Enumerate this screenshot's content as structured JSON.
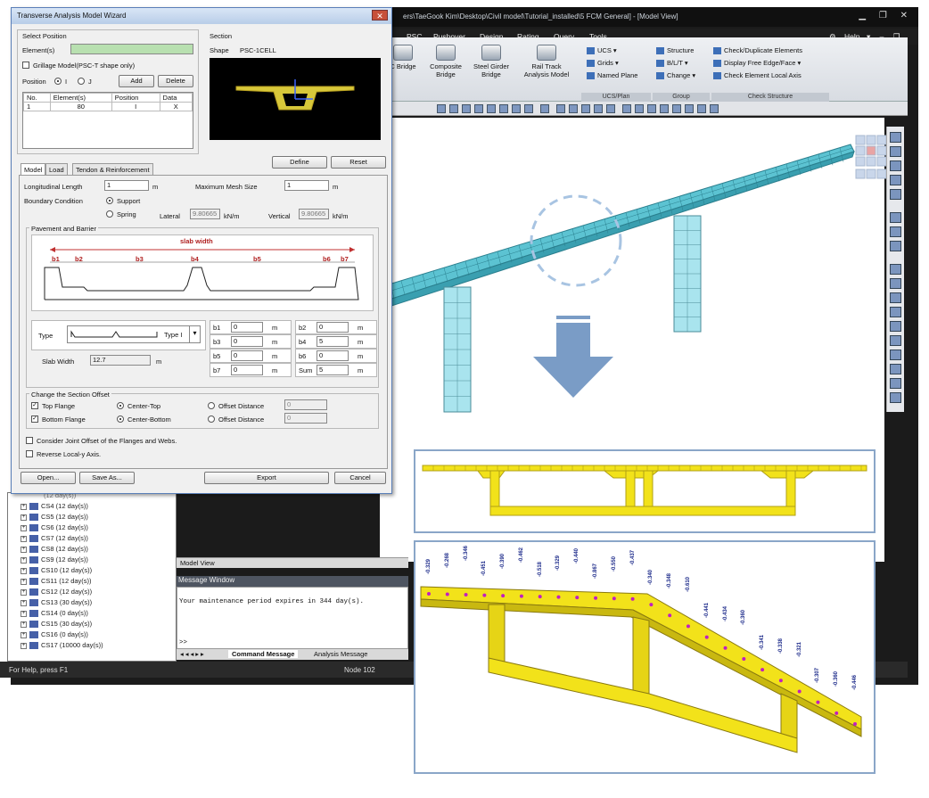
{
  "app": {
    "title_path": "ers\\TaeGook Kim\\Desktop\\Civil model\\Tutorial_installed\\5 FCM General] - [Model View]",
    "help": "Help",
    "menu": [
      "PSC",
      "Pushover",
      "Design",
      "Rating",
      "Query",
      "Tools"
    ],
    "ribbon": {
      "big_buttons": [
        {
          "l1": "C Bridge",
          "l2": ""
        },
        {
          "l1": "Composite",
          "l2": "Bridge"
        },
        {
          "l1": "Steel Girder",
          "l2": "Bridge"
        },
        {
          "l1": "Rail Track",
          "l2": "Analysis Model"
        }
      ],
      "ucs_items": [
        "UCS",
        "Grids",
        "Named Plane"
      ],
      "group_items": [
        "Structure",
        "B/L/T",
        "Change"
      ],
      "check_items": [
        "Check/Duplicate Elements",
        "Display Free Edge/Face",
        "Check Element Local Axis"
      ],
      "group_labels": [
        "UCS/Plan",
        "Group",
        "Check Structure"
      ]
    },
    "tree_items": [
      "CS4 (12 day(s))",
      "CS5 (12 day(s))",
      "CS6 (12 day(s))",
      "CS7 (12 day(s))",
      "CS8 (12 day(s))",
      "CS9 (12 day(s))",
      "CS10 (12 day(s))",
      "CS11 (12 day(s))",
      "CS12 (12 day(s))",
      "CS13 (30 day(s))",
      "CS14 (0 day(s))",
      "CS15 (30 day(s))",
      "CS16 (0 day(s))",
      "CS17 (10000 day(s))"
    ],
    "tree_partial": "(12 day(s))",
    "model_view_tab": "Model View",
    "message_window": "Message Window",
    "message_text": "Your maintenance period expires in 344 day(s).",
    "prompt": ">>",
    "msg_tabs": [
      "Command Message",
      "Analysis Message"
    ],
    "status_left": "For Help, press F1",
    "status_node": "Node 102"
  },
  "dialog": {
    "title": "Transverse Analysis Model Wizard",
    "select_position": "Select Position",
    "elements_label": "Element(s)",
    "grillage": "Grillage Model(PSC-T shape only)",
    "position_label": "Position",
    "pos_i": "I",
    "pos_j": "J",
    "add": "Add",
    "delete": "Delete",
    "table_headers": [
      "No.",
      "Element(s)",
      "Position",
      "Data"
    ],
    "table_rows": [
      [
        "1",
        "80",
        "I",
        "X"
      ]
    ],
    "section": "Section",
    "shape_label": "Shape",
    "shape_value": "PSC-1CELL",
    "tabs": [
      "Model",
      "Load",
      "Tendon & Reinforcement"
    ],
    "define": "Define",
    "reset": "Reset",
    "long_length_label": "Longitudinal Length",
    "long_length": "1",
    "unit_m": "m",
    "max_mesh_label": "Maximum Mesh Size",
    "max_mesh": "1",
    "boundary_label": "Boundary Condition",
    "support": "Support",
    "spring": "Spring",
    "lateral": "Lateral",
    "lateral_val": "9.80665",
    "vertical": "Vertical",
    "vertical_val": "9.80665",
    "spring_unit": "kN/m",
    "pavement": "Pavement and Barrier",
    "slab_width_lbl": "slab width",
    "dims": [
      "b1",
      "b2",
      "b3",
      "b4",
      "b5",
      "b6",
      "b7"
    ],
    "type_label": "Type",
    "type_value": "Type I",
    "slab_width_label": "Slab Width",
    "slab_width": "12.7",
    "b_fields": [
      {
        "k": "b1",
        "v": "0"
      },
      {
        "k": "b2",
        "v": "0"
      },
      {
        "k": "b3",
        "v": "0"
      },
      {
        "k": "b4",
        "v": "5"
      },
      {
        "k": "b5",
        "v": "0"
      },
      {
        "k": "b6",
        "v": "0"
      },
      {
        "k": "b7",
        "v": "0"
      },
      {
        "k": "Sum",
        "v": "5"
      }
    ],
    "offset_title": "Change the Section Offset",
    "top_flange": "Top Flange",
    "bottom_flange": "Bottom Flange",
    "center_top": "Center-Top",
    "center_bottom": "Center-Bottom",
    "offset_distance": "Offset Distance",
    "offset_val": "0",
    "joint_offset": "Consider Joint Offset of the Flanges and Webs.",
    "reverse": "Reverse Local-y Axis.",
    "open": "Open...",
    "save_as": "Save As...",
    "export": "Export",
    "cancel": "Cancel"
  },
  "results": {
    "labels": [
      "-0.329",
      "-0.268",
      "-0.346",
      "-0.451",
      "-0.390",
      "-0.462",
      "-0.518",
      "-0.329",
      "-0.440",
      "-0.867",
      "-0.550",
      "-0.437",
      "-0.340",
      "-0.348",
      "-0.610",
      "-0.441",
      "-0.434",
      "-0.360",
      "-0.341",
      "-0.338",
      "-0.321",
      "-0.307",
      "-0.360",
      "-0.446"
    ]
  },
  "colors": {
    "accent": "#5a7fb8",
    "deck": "#4fb8c8",
    "result": "#f2e21a",
    "arrow": "#7a9cc6"
  }
}
